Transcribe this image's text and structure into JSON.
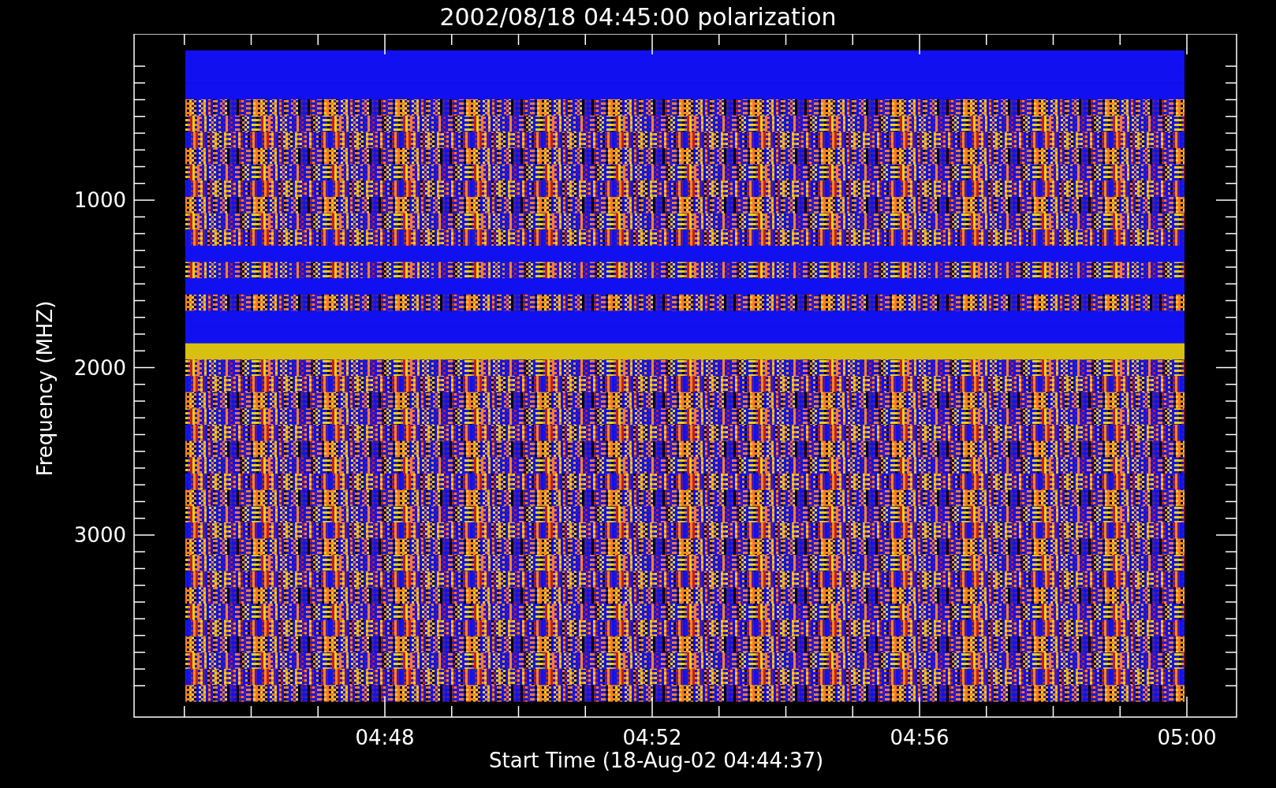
{
  "title": "2002/08/18 04:45:00 polarization",
  "y_axis": {
    "label": "Frequency (MHZ)",
    "ticks": [
      "1000",
      "2000",
      "3000"
    ]
  },
  "x_axis": {
    "label": "Start Time (18-Aug-02 04:44:37)",
    "ticks": [
      "04:48",
      "04:52",
      "04:56",
      "05:00"
    ]
  }
}
